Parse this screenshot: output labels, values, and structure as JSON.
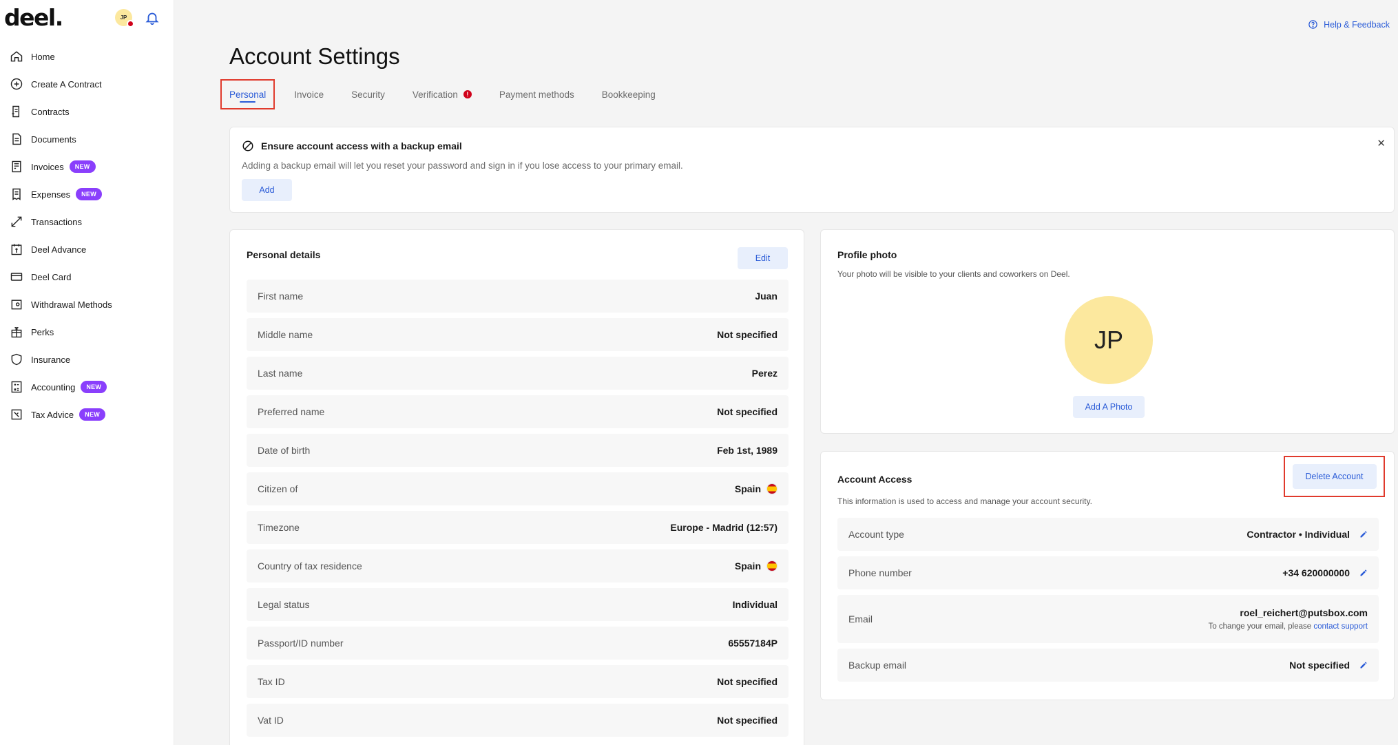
{
  "app": {
    "logo": "deel."
  },
  "user": {
    "initials": "JP"
  },
  "sidebar": {
    "items": [
      {
        "label": "Home",
        "icon": "home-icon"
      },
      {
        "label": "Create A Contract",
        "icon": "plus-circle-icon"
      },
      {
        "label": "Contracts",
        "icon": "contract-icon"
      },
      {
        "label": "Documents",
        "icon": "document-icon"
      },
      {
        "label": "Invoices",
        "icon": "invoice-icon",
        "badge": "NEW"
      },
      {
        "label": "Expenses",
        "icon": "receipt-icon",
        "badge": "NEW"
      },
      {
        "label": "Transactions",
        "icon": "arrows-icon"
      },
      {
        "label": "Deel Advance",
        "icon": "calendar-dollar-icon"
      },
      {
        "label": "Deel Card",
        "icon": "card-icon"
      },
      {
        "label": "Withdrawal Methods",
        "icon": "wallet-icon"
      },
      {
        "label": "Perks",
        "icon": "gift-icon"
      },
      {
        "label": "Insurance",
        "icon": "shield-icon"
      },
      {
        "label": "Accounting",
        "icon": "calculator-icon",
        "badge": "NEW"
      },
      {
        "label": "Tax Advice",
        "icon": "tax-icon",
        "badge": "NEW"
      }
    ]
  },
  "header": {
    "help": "Help & Feedback",
    "title": "Account Settings"
  },
  "tabs": [
    {
      "label": "Personal"
    },
    {
      "label": "Invoice"
    },
    {
      "label": "Security"
    },
    {
      "label": "Verification",
      "alert": "!"
    },
    {
      "label": "Payment methods"
    },
    {
      "label": "Bookkeeping"
    }
  ],
  "banner": {
    "title": "Ensure account access with a backup email",
    "text": "Adding a backup email will let you reset your password and sign in if you lose access to your primary email.",
    "add": "Add",
    "close": "✕"
  },
  "personal": {
    "title": "Personal details",
    "edit": "Edit",
    "rows": [
      {
        "label": "First name",
        "value": "Juan"
      },
      {
        "label": "Middle name",
        "value": "Not specified"
      },
      {
        "label": "Last name",
        "value": "Perez"
      },
      {
        "label": "Preferred name",
        "value": "Not specified"
      },
      {
        "label": "Date of birth",
        "value": "Feb 1st, 1989"
      },
      {
        "label": "Citizen of",
        "value": "Spain"
      },
      {
        "label": "Timezone",
        "value": "Europe - Madrid (12:57)"
      },
      {
        "label": "Country of tax residence",
        "value": "Spain"
      },
      {
        "label": "Legal status",
        "value": "Individual"
      },
      {
        "label": "Passport/ID number",
        "value": "65557184P"
      },
      {
        "label": "Tax ID",
        "value": "Not specified"
      },
      {
        "label": "Vat ID",
        "value": "Not specified"
      }
    ]
  },
  "photo": {
    "title": "Profile photo",
    "subtitle": "Your photo will be visible to your clients and coworkers on Deel.",
    "initials": "JP",
    "add": "Add A Photo"
  },
  "access": {
    "title": "Account Access",
    "subtitle": "This information is used to access and manage your account security.",
    "delete": "Delete Account",
    "account_type": {
      "label": "Account type",
      "value": "Contractor • Individual"
    },
    "phone": {
      "label": "Phone number",
      "value": "+34 620000000"
    },
    "email": {
      "label": "Email",
      "value": "roel_reichert@putsbox.com",
      "note": "To change your email, please",
      "link": "contact support"
    },
    "backup": {
      "label": "Backup email",
      "value": "Not specified"
    }
  }
}
